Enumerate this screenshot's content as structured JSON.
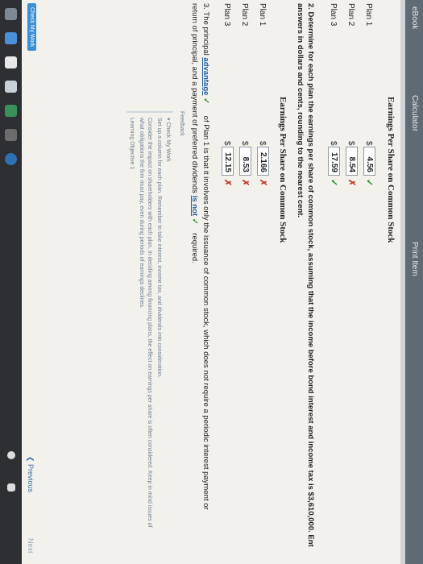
{
  "toolbar": {
    "ebook": "eBook",
    "calculator": "Calculator",
    "print_item": "Print Item"
  },
  "part1": {
    "heading": "Earnings Per Share on Common Stock",
    "rows": [
      {
        "label": "Plan 1",
        "currency": "$",
        "value": "4.56",
        "mark": "✓"
      },
      {
        "label": "Plan 2",
        "currency": "$",
        "value": "8.54",
        "mark": "✗"
      },
      {
        "label": "Plan 3",
        "currency": "$",
        "value": "17.59",
        "mark": "✓"
      }
    ]
  },
  "question2": {
    "line1": "2. Determine for each plan the earnings per share of common stock, assuming that the income before bond interest and income tax is $3,610,000. Ent",
    "line2": "answers in dollars and cents, rounding to the nearest cent."
  },
  "part2": {
    "heading": "Earnings Per Share on Common Stock",
    "rows": [
      {
        "label": "Plan 1",
        "currency": "$",
        "value": "2.166",
        "mark": "✗"
      },
      {
        "label": "Plan 2",
        "currency": "$",
        "value": "8.53",
        "mark": "✗"
      },
      {
        "label": "Plan 3",
        "currency": "$",
        "value": "12.15",
        "mark": "✗"
      }
    ]
  },
  "question3": {
    "prefix": "3. The principal",
    "dropdown1": "advantage",
    "dropdown1_mark": "✓",
    "middle": "of Plan 1 is that it involves only the issuance of common stock, which does not require a periodic interest payment or",
    "line2_prefix": "return of principal, and a payment of preferred dividends",
    "dropdown2": "is not",
    "dropdown2_mark": "✓",
    "line2_suffix": "required."
  },
  "feedback": {
    "label": "Feedback",
    "check_my_work": "▾ Check My Work",
    "line1": "Set up a column for each plan. Remember to take interest, income tax, and dividends into consideration.",
    "line2": "Consider the impact on shareholders with each plan. In deciding among financing plans, the effect on earnings per share is often considered. Keep in mind issues of",
    "line3": "what obligations the firm must pay, even during periods of earnings declines.",
    "line4": "Learning Objective 1"
  },
  "footer": {
    "check_button": "Check My Work",
    "previous": "❮ Previous",
    "next": "Next"
  },
  "colors": {
    "correct": "#2e8b2e",
    "incorrect": "#c0392b",
    "link": "#1f5fa0"
  }
}
